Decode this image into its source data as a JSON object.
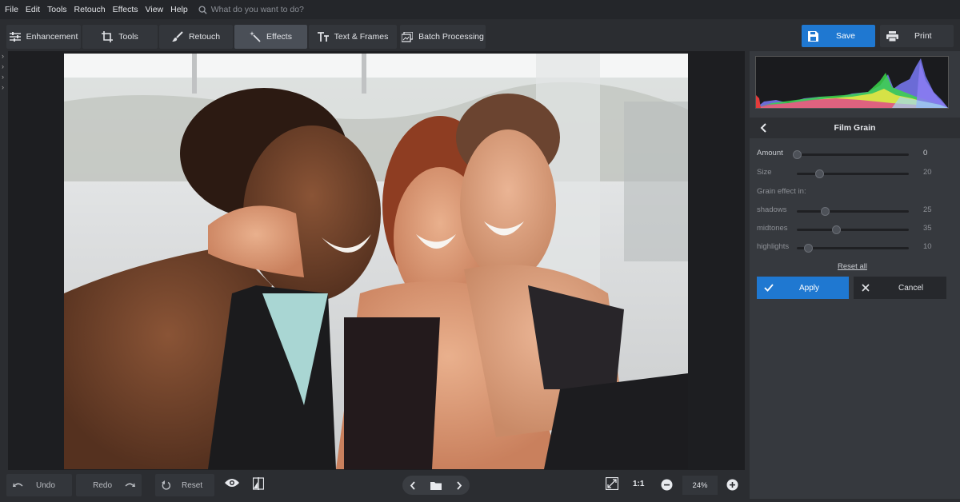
{
  "menu": [
    "File",
    "Edit",
    "Tools",
    "Retouch",
    "Effects",
    "View",
    "Help"
  ],
  "search": {
    "placeholder": "What do you want to do?"
  },
  "tabs": [
    {
      "label": "Enhancement",
      "icon": "sliders-icon"
    },
    {
      "label": "Tools",
      "icon": "crop-icon"
    },
    {
      "label": "Retouch",
      "icon": "brush-icon"
    },
    {
      "label": "Effects",
      "icon": "magic-wand-icon",
      "active": true
    },
    {
      "label": "Text & Frames",
      "icon": "text-icon"
    },
    {
      "label": "Batch Processing",
      "icon": "batch-icon"
    }
  ],
  "actions": {
    "save": "Save",
    "print": "Print",
    "accent": "#1f78d1"
  },
  "panel": {
    "title": "Film Grain",
    "grain_label": "Grain effect in:",
    "reset_all": "Reset all",
    "apply": "Apply",
    "cancel": "Cancel",
    "sliders": [
      {
        "label": "Amount",
        "value": "0",
        "level": 0.0
      },
      {
        "label": "Size",
        "value": "20",
        "level": 0.2
      },
      {
        "label": "shadows",
        "value": "25",
        "level": 0.25
      },
      {
        "label": "midtones",
        "value": "35",
        "level": 0.35
      },
      {
        "label": "highlights",
        "value": "10",
        "level": 0.1
      }
    ]
  },
  "bottom": {
    "undo": "Undo",
    "redo": "Redo",
    "reset": "Reset",
    "ratio": "1:1",
    "zoom": "24%"
  }
}
